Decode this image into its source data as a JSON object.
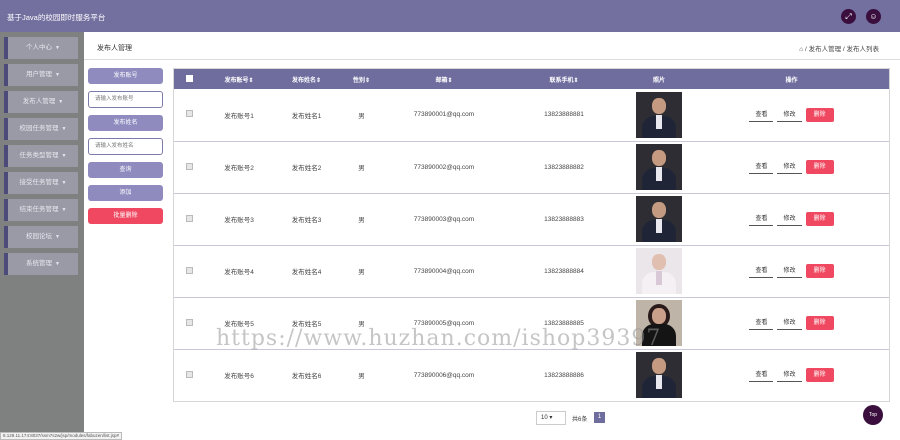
{
  "app": {
    "title": "基于Java的校园即时服务平台"
  },
  "header": {
    "icons": [
      "expand-icon",
      "user-icon"
    ]
  },
  "sidebar": {
    "items": [
      {
        "label": "个人中心"
      },
      {
        "label": "用户管理"
      },
      {
        "label": "发布人管理"
      },
      {
        "label": "校园任务管理"
      },
      {
        "label": "任务类型管理"
      },
      {
        "label": "接受任务管理"
      },
      {
        "label": "结束任务管理"
      },
      {
        "label": "校园论坛"
      },
      {
        "label": "系统管理"
      }
    ]
  },
  "page": {
    "title": "发布人管理",
    "breadcrumb": "/ 发布人管理 / 发布人列表"
  },
  "search": {
    "account_label": "发布账号",
    "account_placeholder": "请输入发布账号",
    "name_label": "发布姓名",
    "name_placeholder": "请输入发布姓名",
    "query_label": "查询",
    "add_label": "添加",
    "batch_delete_label": "批量删除"
  },
  "table": {
    "headers": [
      "发布账号⇕",
      "发布姓名⇕",
      "性别⇕",
      "邮箱⇕",
      "联系手机⇕",
      "照片",
      "操作"
    ],
    "actions": {
      "view": "查看",
      "edit": "修改",
      "delete": "删除"
    },
    "rows": [
      {
        "account": "发布账号1",
        "name": "发布姓名1",
        "gender": "男",
        "email": "773890001@qq.com",
        "phone": "13823888881",
        "photo": "man-suit-photo"
      },
      {
        "account": "发布账号2",
        "name": "发布姓名2",
        "gender": "男",
        "email": "773890002@qq.com",
        "phone": "13823888882",
        "photo": "man-suit-photo"
      },
      {
        "account": "发布账号3",
        "name": "发布姓名3",
        "gender": "男",
        "email": "773890003@qq.com",
        "phone": "13823888883",
        "photo": "man-suit-photo"
      },
      {
        "account": "发布账号4",
        "name": "发布姓名4",
        "gender": "男",
        "email": "773890004@qq.com",
        "phone": "13823888884",
        "photo": "woman-light-photo"
      },
      {
        "account": "发布账号5",
        "name": "发布姓名5",
        "gender": "男",
        "email": "773890005@qq.com",
        "phone": "13823888885",
        "photo": "woman-dark-photo"
      },
      {
        "account": "发布账号6",
        "name": "发布姓名6",
        "gender": "男",
        "email": "773890006@qq.com",
        "phone": "13823888886",
        "photo": "man-suit-photo"
      }
    ]
  },
  "pager": {
    "page_size": "10",
    "total_label": "共6条",
    "current_page": "1"
  },
  "top_button": "Top",
  "watermark": "https://www.huzhan.com/ishop39397",
  "statusbar": "8.129.11.174:8037/ssm7s2w/jsp/modules/fabuzen/list.jsp#",
  "colors": {
    "header": "#736f9f",
    "accent": "#6f6c9e",
    "danger": "#ef4860",
    "dark_button": "#3a0f3e"
  }
}
